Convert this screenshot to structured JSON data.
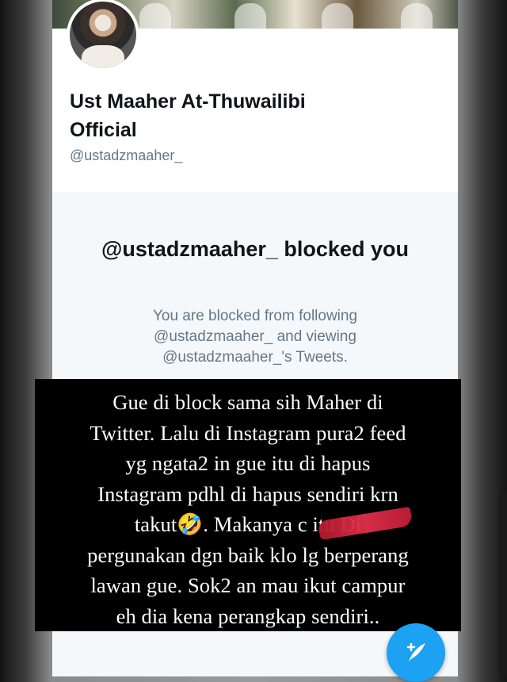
{
  "profile": {
    "name": "Ust Maaher At-Thuwailibi Official",
    "handle": "@ustadzmaaher_"
  },
  "blocked": {
    "title": "@ustadzmaaher_ blocked you",
    "message": "You are blocked from following @ustadzmaaher_ and viewing @ustadzmaaher_'s Tweets."
  },
  "caption": {
    "lines": [
      "Gue di block sama sih Maher di",
      "Twitter. Lalu di Instagram pura2 feed",
      "yg ngata2 in gue itu di hapus",
      "Instagram pdhl di hapus sendiri krn",
      "takut🤣. Makanya c         itu Di",
      "pergunakan dgn baik klo lg berperang",
      "lawan gue. Sok2 an mau ikut campur",
      "eh dia kena perangkap sendiri.."
    ]
  },
  "icons": {
    "compose": "compose-tweet-icon"
  },
  "colors": {
    "accent": "#1da1f2",
    "muted_text": "#657786",
    "panel_bg": "#f5f8fa"
  }
}
